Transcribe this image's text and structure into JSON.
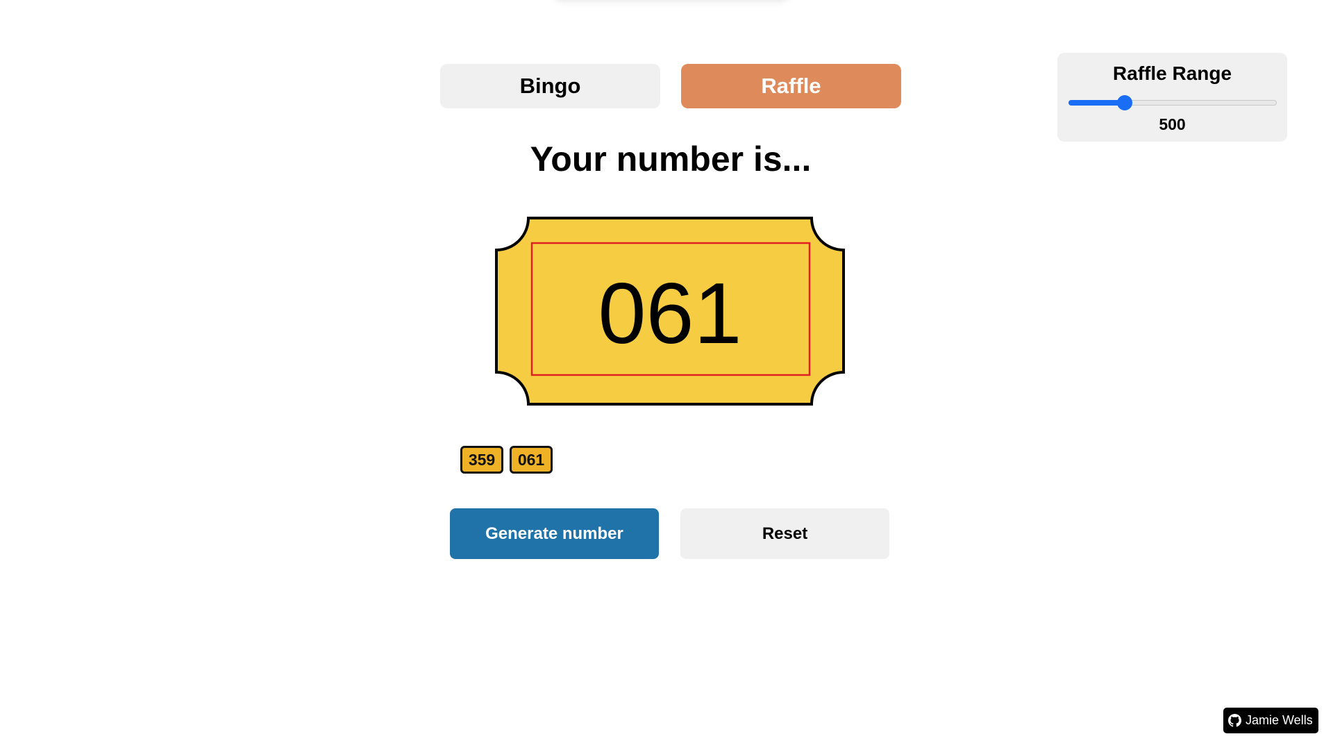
{
  "modes": {
    "bingo_label": "Bingo",
    "raffle_label": "Raffle",
    "active": "Raffle"
  },
  "heading": "Your number is...",
  "current_number": "061",
  "history": [
    "359",
    "061"
  ],
  "actions": {
    "generate_label": "Generate number",
    "reset_label": "Reset"
  },
  "raffle_range": {
    "title": "Raffle Range",
    "value": "500",
    "slider_fraction": 0.27
  },
  "credit": {
    "label": "Jamie Wells",
    "icon": "github-icon"
  },
  "colors": {
    "active_mode": "#df8a5a",
    "generate_button": "#1f73a8",
    "ticket_fill": "#f6cc43",
    "ticket_inner_border": "#e02020",
    "history_chip": "#efb125",
    "slider_accent": "#1a6ef5"
  }
}
